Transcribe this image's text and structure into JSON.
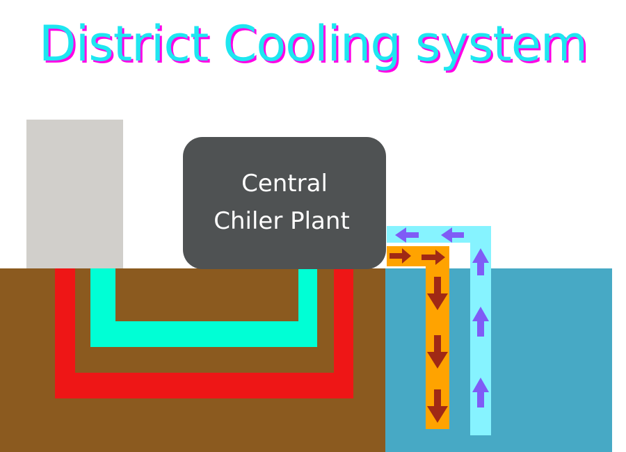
{
  "title": "District Cooling system",
  "plant": {
    "label_line1": "Central",
    "label_line2": "Chiler Plant"
  },
  "colors": {
    "title_fill": "#1ee6f0",
    "title_shadow": "#ff00e6",
    "ground": "#8b5a1f",
    "water": "#47a9c5",
    "building": "#d1cfcb",
    "plant": "#4f5253",
    "supply_pipe": "#00ffd5",
    "return_pipe": "#ee1616",
    "warm_pipe": "#ffa300",
    "cool_pipe": "#86f3ff",
    "warm_arrow": "#a02915",
    "cool_arrow": "#7f5cf6"
  }
}
